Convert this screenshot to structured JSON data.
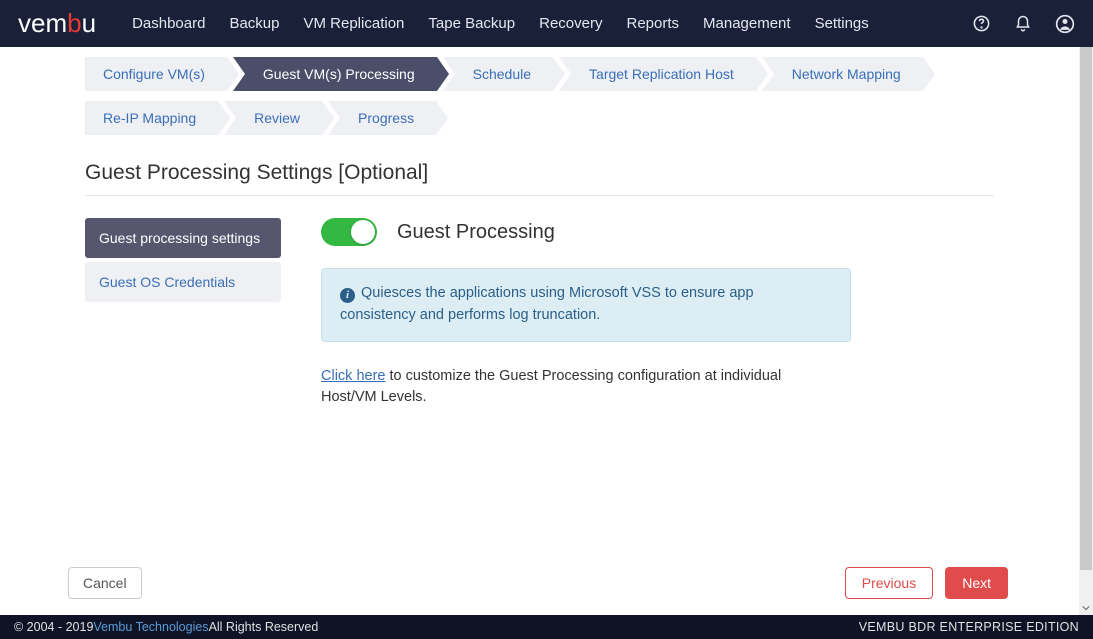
{
  "logo": {
    "part1": "vem",
    "accent": "b",
    "part2": "u"
  },
  "nav": {
    "items": [
      "Dashboard",
      "Backup",
      "VM Replication",
      "Tape Backup",
      "Recovery",
      "Reports",
      "Management",
      "Settings"
    ]
  },
  "wizard_steps": [
    {
      "label": "Configure VM(s)",
      "active": false
    },
    {
      "label": "Guest VM(s) Processing",
      "active": true
    },
    {
      "label": "Schedule",
      "active": false
    },
    {
      "label": "Target Replication Host",
      "active": false
    },
    {
      "label": "Network Mapping",
      "active": false
    },
    {
      "label": "Re-IP Mapping",
      "active": false
    },
    {
      "label": "Review",
      "active": false
    },
    {
      "label": "Progress",
      "active": false
    }
  ],
  "page_title": "Guest Processing Settings [Optional]",
  "side_tabs": [
    {
      "label": "Guest processing settings",
      "active": true
    },
    {
      "label": "Guest OS Credentials",
      "active": false
    }
  ],
  "guest_processing": {
    "enabled": true,
    "title": "Guest Processing",
    "info": "Quiesces the applications using Microsoft VSS to ensure app consistency and performs log truncation.",
    "customize_link": "Click here",
    "customize_text": " to customize the Guest Processing configuration at individual Host/VM Levels."
  },
  "buttons": {
    "cancel": "Cancel",
    "previous": "Previous",
    "next": "Next"
  },
  "footer": {
    "copyright_prefix": "© 2004 - 2019 ",
    "company_link": "Vembu Technologies",
    "copyright_suffix": " All Rights Reserved",
    "edition": "VEMBU BDR ENTERPRISE EDITION"
  }
}
